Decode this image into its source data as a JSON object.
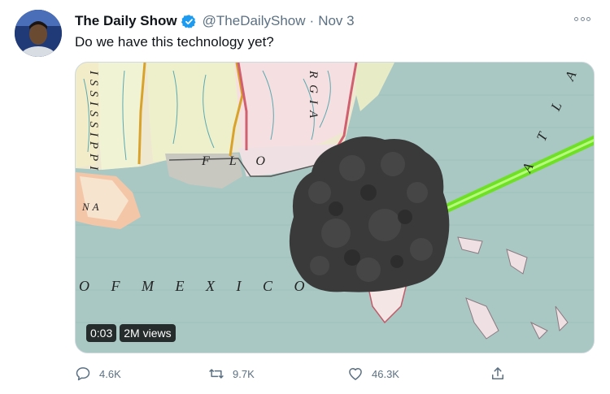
{
  "tweet": {
    "display_name": "The Daily Show",
    "handle": "@TheDailyShow",
    "separator": "·",
    "date": "Nov 3",
    "text": "Do we have this technology yet?",
    "verified": true
  },
  "media": {
    "type": "video",
    "timestamp": "0:03",
    "views": "2M views",
    "map_labels": {
      "state_left": "ISSISSIPPI",
      "florida": "F L O",
      "georgia": "RGIA",
      "atlantic": "A T L A",
      "gulf": "O F   M E X I C O",
      "state_na": "NA"
    }
  },
  "actions": {
    "reply": {
      "icon": "reply-icon",
      "count": "4.6K"
    },
    "retweet": {
      "icon": "retweet-icon",
      "count": "9.7K"
    },
    "like": {
      "icon": "heart-icon",
      "count": "46.3K"
    },
    "share": {
      "icon": "share-icon"
    }
  },
  "colors": {
    "text": "#0f1419",
    "secondary": "#5b7083",
    "verified": "#1d9bf0",
    "map_water": "#a9c8c3",
    "laser": "#6fe025",
    "rock": "#3a3a3a"
  }
}
